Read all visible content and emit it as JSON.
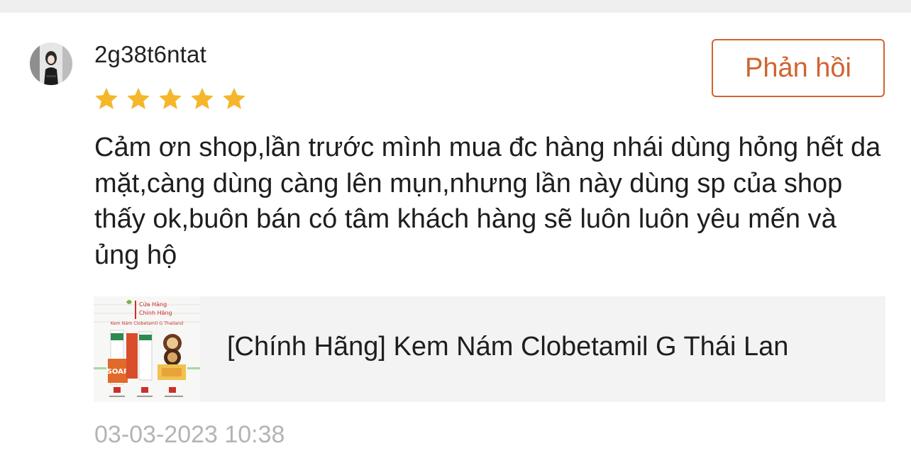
{
  "review": {
    "username": "2g38t6ntat",
    "rating": 5,
    "max_rating": 5,
    "reply_label": "Phản hồi",
    "comment": "Cảm ơn shop,lần trước mình mua đc hàng nhái dùng hỏng hết da mặt,càng dùng càng lên mụn,nhưng lần này dùng sp của shop thấy ok,buôn bán có tâm khách hàng sẽ luôn luôn yêu mến và ủng hộ",
    "timestamp": "03-03-2023 10:38"
  },
  "product": {
    "name": "[Chính Hãng] Kem Nám Clobetamil G Thái Lan",
    "thumbnail_text": {
      "line1": "Cửa Hàng",
      "line2": "Chính Hãng",
      "banner": "Kem Nám Clobetamil G Thailand",
      "soap": "SOAP"
    }
  },
  "colors": {
    "accent": "#d0642f",
    "star": "#f6b62b",
    "timestamp": "#b4b4b4",
    "card_bg": "#f3f3f3",
    "top_strip": "#efefef"
  },
  "icons": {
    "star": "star-icon",
    "avatar": "user-avatar"
  }
}
